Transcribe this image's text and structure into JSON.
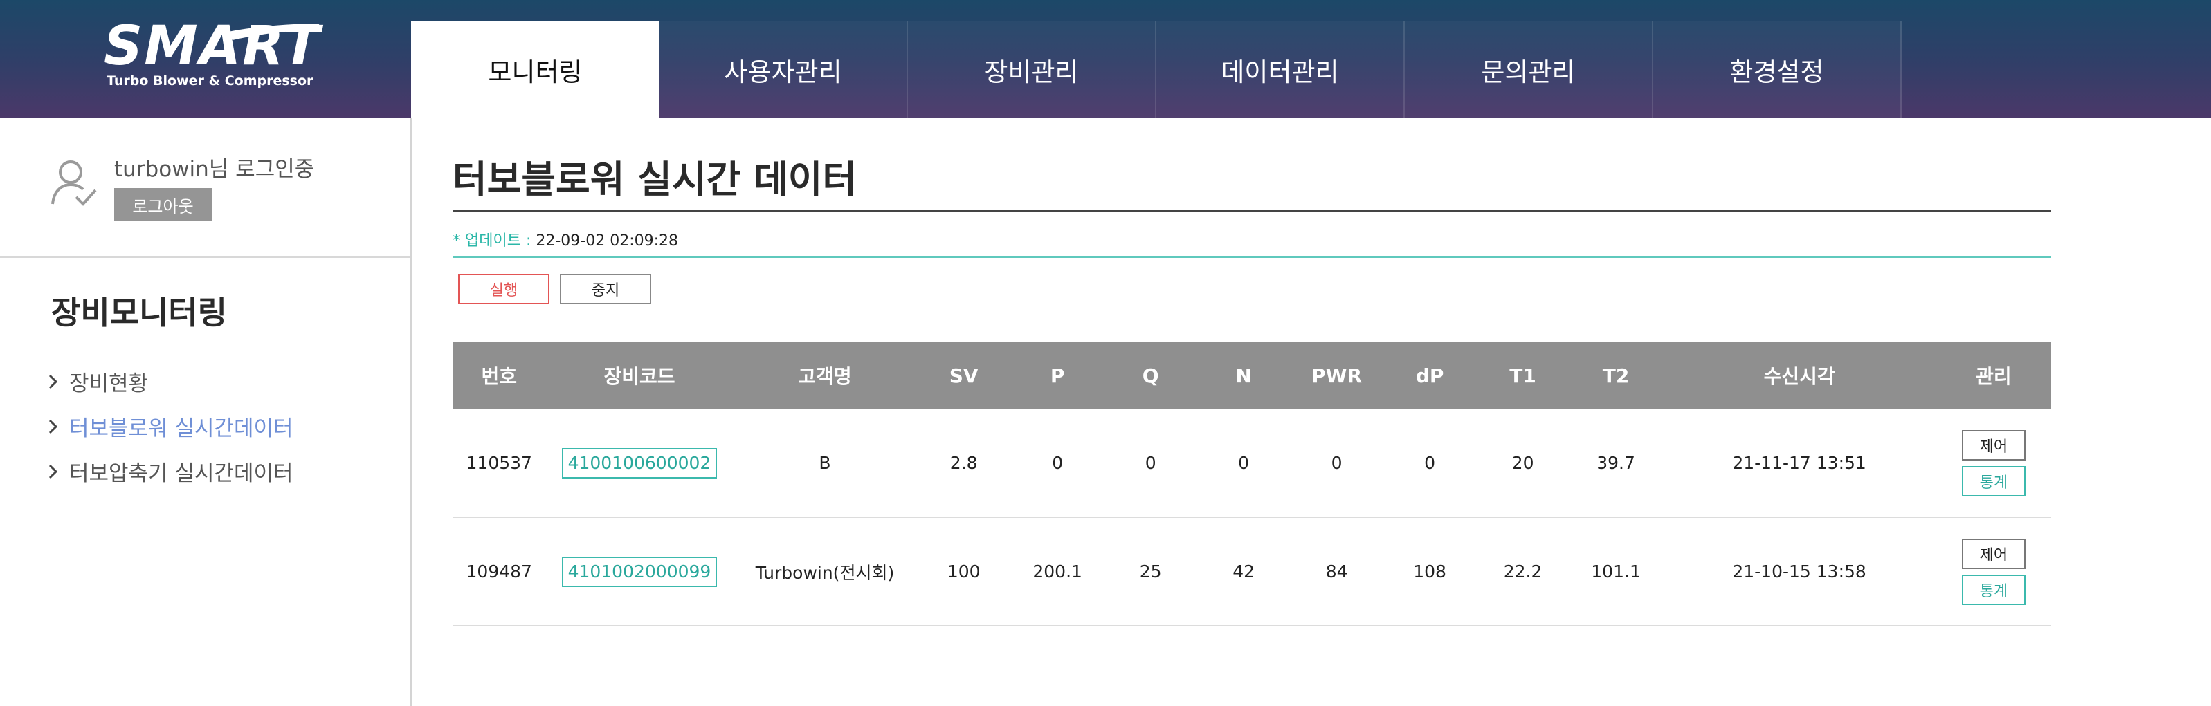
{
  "logo": {
    "main": "SMART",
    "sub": "Turbo Blower & Compressor"
  },
  "nav": {
    "tabs": [
      {
        "label": "모니터링",
        "active": true
      },
      {
        "label": "사용자관리",
        "active": false
      },
      {
        "label": "장비관리",
        "active": false
      },
      {
        "label": "데이터관리",
        "active": false
      },
      {
        "label": "문의관리",
        "active": false
      },
      {
        "label": "환경설정",
        "active": false
      }
    ]
  },
  "sidebar": {
    "user": {
      "name": "turbowin",
      "suffix": "님 로그인중"
    },
    "logout_label": "로그아웃",
    "section_title": "장비모니터링",
    "items": [
      {
        "label": "장비현황",
        "active": false
      },
      {
        "label": "터보블로워 실시간데이터",
        "active": true
      },
      {
        "label": "터보압축기 실시간데이터",
        "active": false
      }
    ]
  },
  "main": {
    "title": "터보블로워 실시간 데이터",
    "update_label": "* 업데이트 : ",
    "update_value": "22-09-02 02:09:28",
    "run_label": "실행",
    "stop_label": "중지"
  },
  "table": {
    "headers": [
      "번호",
      "장비코드",
      "고객명",
      "SV",
      "P",
      "Q",
      "N",
      "PWR",
      "dP",
      "T1",
      "T2",
      "수신시각",
      "관리"
    ],
    "rows": [
      {
        "no": "110537",
        "code": "4100100600002",
        "customer": "B",
        "sv": "2.8",
        "p": "0",
        "q": "0",
        "n": "0",
        "pwr": "0",
        "dp": "0",
        "t1": "20",
        "t2": "39.7",
        "received": "21-11-17 13:51",
        "control_label": "제어",
        "stats_label": "통계"
      },
      {
        "no": "109487",
        "code": "4101002000099",
        "customer": "Turbowin(전시회)",
        "sv": "100",
        "p": "200.1",
        "q": "25",
        "n": "42",
        "pwr": "84",
        "dp": "108",
        "t1": "22.2",
        "t2": "101.1",
        "received": "21-10-15 13:58",
        "control_label": "제어",
        "stats_label": "통계"
      }
    ]
  },
  "colors": {
    "header_gradient_top": "#1c4868",
    "header_gradient_bottom": "#4b3869",
    "accent_teal": "#3bb9ad",
    "run_red": "#e35555",
    "active_menu_blue": "#6f8fd6",
    "table_header_gray": "#8f8f8f"
  },
  "icons": {
    "user": "user-check-icon",
    "chevron": "chevron-right-icon"
  }
}
